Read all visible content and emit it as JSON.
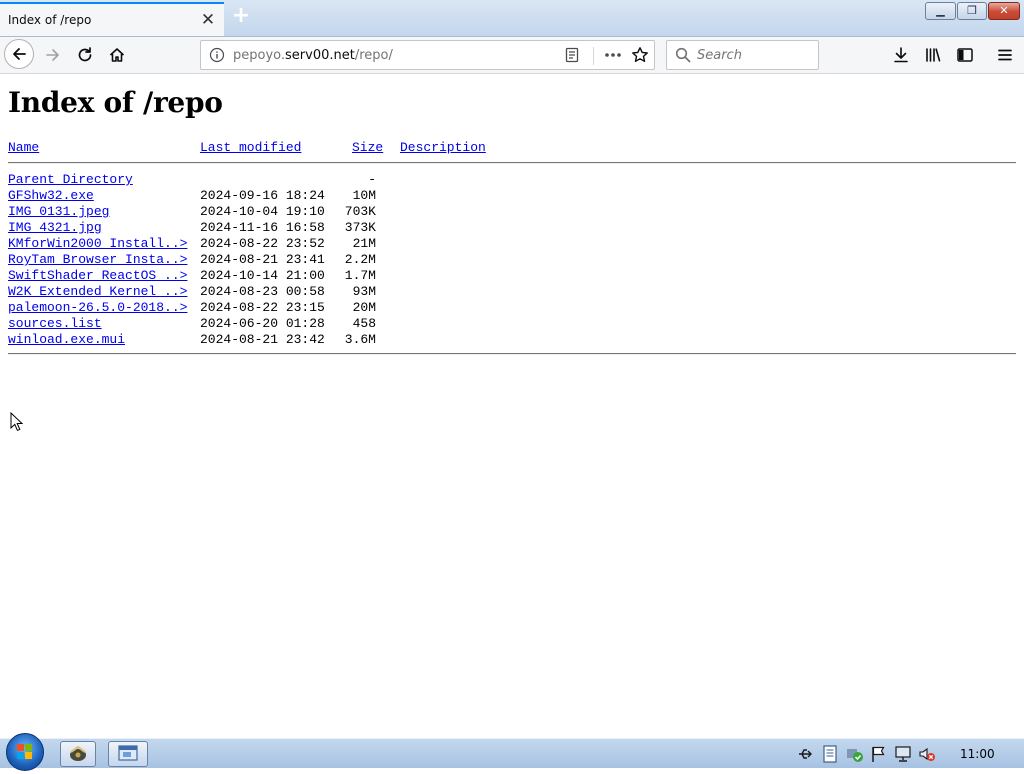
{
  "tab": {
    "title": "Index of /repo"
  },
  "address": {
    "url_prefix": "pepoyo.",
    "url_host": "serv00.net",
    "url_path": "/repo/"
  },
  "search": {
    "placeholder": "Search"
  },
  "page": {
    "title": "Index of /repo",
    "columns": {
      "name": "Name",
      "modified": "Last modified",
      "size": "Size",
      "description": "Description"
    },
    "parent": {
      "name": "Parent Directory",
      "size": "-"
    },
    "files": [
      {
        "name": "GFShw32.exe",
        "modified": "2024-09-16 18:24",
        "size": "10M"
      },
      {
        "name": "IMG_0131.jpeg",
        "modified": "2024-10-04 19:10",
        "size": "703K"
      },
      {
        "name": "IMG_4321.jpg",
        "modified": "2024-11-16 16:58",
        "size": "373K"
      },
      {
        "name": "KMforWin2000_Install..>",
        "modified": "2024-08-22 23:52",
        "size": "21M"
      },
      {
        "name": "RoyTam Browser Insta..>",
        "modified": "2024-08-21 23:41",
        "size": "2.2M"
      },
      {
        "name": "SwiftShader ReactOS ..>",
        "modified": "2024-10-14 21:00",
        "size": "1.7M"
      },
      {
        "name": "W2K Extended Kernel ..>",
        "modified": "2024-08-23 00:58",
        "size": "93M"
      },
      {
        "name": "palemoon-26.5.0-2018..>",
        "modified": "2024-08-22 23:15",
        "size": "20M"
      },
      {
        "name": "sources.list",
        "modified": "2024-06-20 01:28",
        "size": "458"
      },
      {
        "name": "winload.exe.mui",
        "modified": "2024-08-21 23:42",
        "size": "3.6M"
      }
    ]
  },
  "taskbar": {
    "clock": "11:00"
  },
  "colors": {
    "link": "#0000ee",
    "tab_accent": "#0a84ff",
    "chrome": "#f5f6f7"
  }
}
